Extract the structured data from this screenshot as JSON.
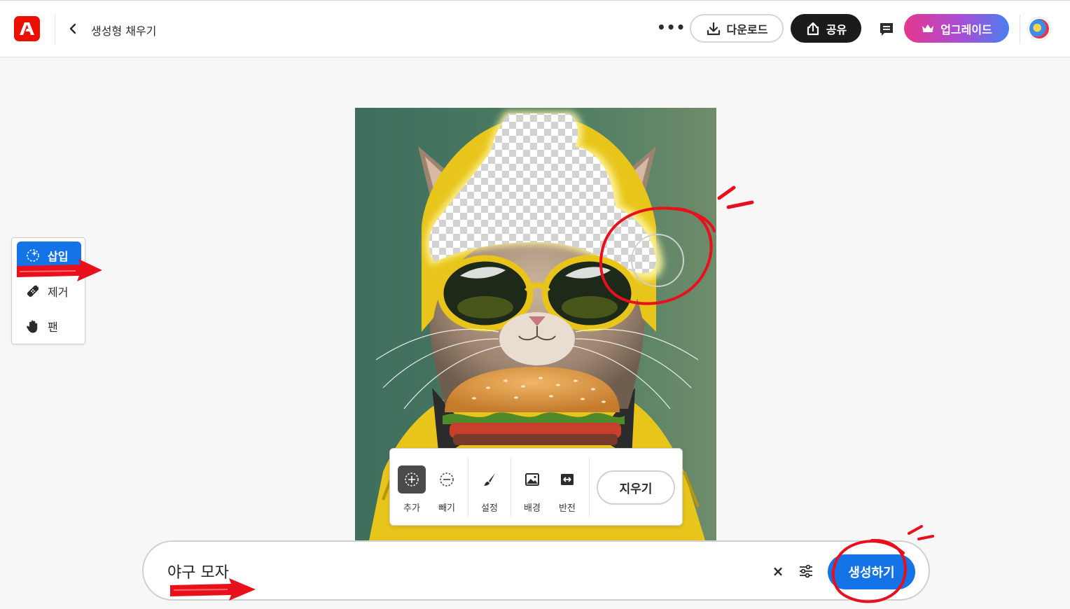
{
  "app": {
    "title": "생성형 채우기",
    "logo_icon": "adobe-express-logo",
    "brand_color": "#eb1000"
  },
  "header": {
    "back_icon": "chevron-left-icon",
    "more_label": "•••",
    "download_label": "다운로드",
    "share_label": "공유",
    "upgrade_label": "업그레이드",
    "comment_icon": "comment-icon",
    "avatar_icon": "user-avatar"
  },
  "tools": {
    "items": [
      {
        "label": "삽입",
        "icon": "sparkle-dashed-circle-icon",
        "active": true
      },
      {
        "label": "제거",
        "icon": "eraser-bandage-icon",
        "active": false
      },
      {
        "label": "팬",
        "icon": "hand-icon",
        "active": false
      }
    ]
  },
  "brushbar": {
    "items": [
      {
        "label": "추가",
        "icon": "add-selection-icon",
        "active": true
      },
      {
        "label": "빼기",
        "icon": "subtract-selection-icon",
        "active": false
      },
      {
        "label": "설정",
        "icon": "brush-icon",
        "active": false
      },
      {
        "label": "배경",
        "icon": "image-background-icon",
        "active": false
      },
      {
        "label": "반전",
        "icon": "invert-icon",
        "active": false
      }
    ],
    "erase_label": "지우기"
  },
  "prompt": {
    "value": "야구 모자",
    "clear_label": "×",
    "generate_label": "생성하기"
  },
  "colors": {
    "accent": "#1473e6",
    "annotation_red": "#e8101c"
  }
}
